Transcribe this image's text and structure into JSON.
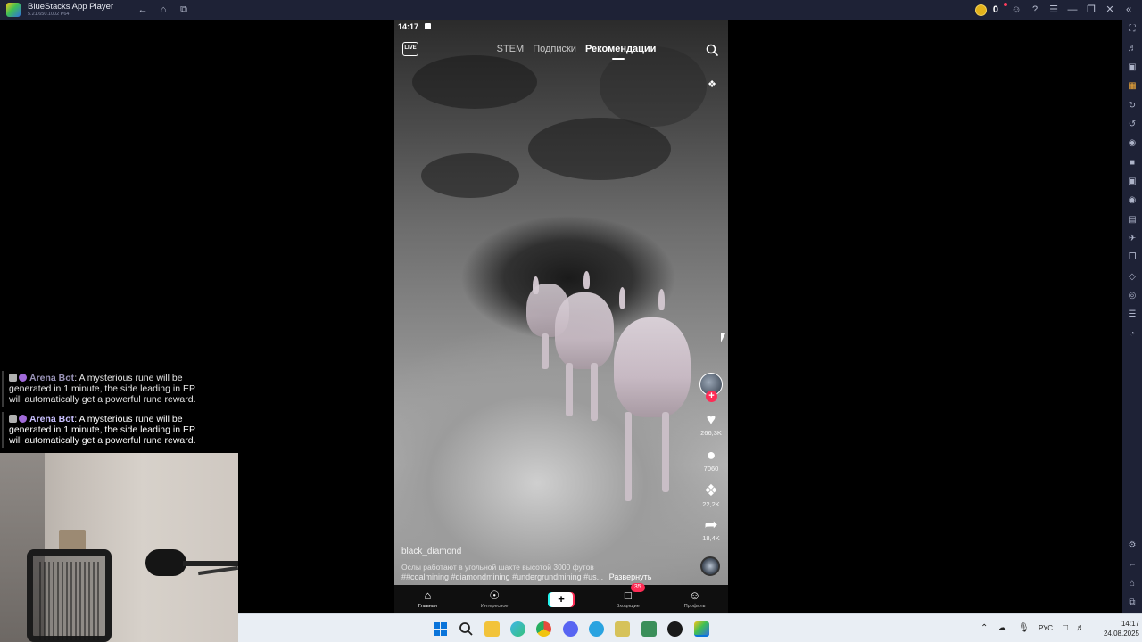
{
  "window": {
    "app_name": "BlueStacks App Player",
    "app_version": "5.21.650.1002 P64",
    "coin_count": "0",
    "accent_color": "#f0a93a",
    "titlebar_color": "#1e2236"
  },
  "phone": {
    "status_time": "14:17",
    "tabs": [
      "STEM",
      "Подписки",
      "Рекомендации"
    ],
    "active_tab": "Рекомендации",
    "live_label": "LIVE",
    "actions": {
      "likes": "266,3K",
      "comments": "7060",
      "saves": "22,2K",
      "shares": "18,4K"
    },
    "username": "black_diamond",
    "caption": "Ослы работают в угольной шахте высотой 3000 футов",
    "hashtags": "##coalmining #diamondmining #undergrundmining #us...",
    "expand_label": "Развернуть",
    "nav": [
      {
        "label": "Главная",
        "icon": "home-icon"
      },
      {
        "label": "Интересное",
        "icon": "compass-icon"
      },
      {
        "label": "",
        "icon": "plus-icon"
      },
      {
        "label": "Входящие",
        "icon": "inbox-icon",
        "badge": "35"
      },
      {
        "label": "Профиль",
        "icon": "profile-icon"
      }
    ],
    "brand_colors": {
      "pink": "#fe2c55",
      "cyan": "#25f4ee"
    }
  },
  "chat": [
    {
      "bot": "Arena Bot",
      "message": ": A mysterious rune will be generated in 1 minute, the side leading in EP will automatically get a powerful rune reward."
    },
    {
      "bot": "Arena Bot",
      "message": ": A mysterious rune will be generated in 1 minute, the side leading in EP will automatically get a powerful rune reward."
    }
  ],
  "taskbar": {
    "language": "РУС",
    "time": "14:17",
    "date": "24.08.2025"
  }
}
